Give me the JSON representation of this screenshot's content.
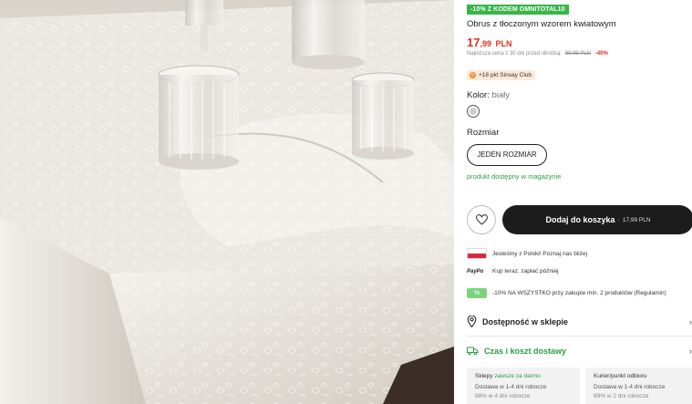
{
  "photo": {
    "alt_icon": "tablecloth-photo"
  },
  "product": {
    "promo_badge": "-10% Z KODEM OMNITOTAL10",
    "title": "Obrus z tłoczonym wzorem kwiatowym",
    "price_int": "17",
    "price_dec": ",99",
    "price_cur": "PLN",
    "lowest_label": "Najniższa cena z 30 dni przed obniżką:",
    "lowest_old": "89,99 PLN",
    "lowest_pct": "-40%",
    "club_dot": "◎",
    "club_text": "+18 pkt Sinsay Club",
    "color_label": "Kolor:",
    "color_value": "biały",
    "size_label": "Rozmiar",
    "size_option": "JEDEN ROZMIAR",
    "availability": "produkt dostępny w magazynie",
    "cart_label": "Dodaj do koszyka",
    "cart_sep": "·",
    "cart_price": "17,99 PLN"
  },
  "info": {
    "poland": "Jesteśmy z Polski! Poznaj nas bliżej",
    "paypo_logo": "PayPo",
    "paypo": "Kup teraz, zapłać później",
    "discount": "-10% NA WSZYSTKO przy zakupie min. 2 produktów (Regulamin)"
  },
  "availability_row": {
    "label": "Dostępność w sklepie",
    "chevron": "›"
  },
  "delivery_row": {
    "label": "Czas i koszt dostawy",
    "chevron": "›"
  },
  "delivery_cards": [
    {
      "head": "Sklepy",
      "head_green": "zawsze za darmo",
      "line1": "Dostawa w 1-4 dni robocze",
      "line2": "98% w 4 dni robocze"
    },
    {
      "head": "Kurier/punkt odbioru",
      "head_green": "",
      "line1": "Dostawa w 1-4 dni robocze",
      "line2": "69% w 2 dni robocze"
    }
  ],
  "colors": {
    "price": "#e0301e",
    "green": "#38b549",
    "button": "#1c1c1c"
  }
}
